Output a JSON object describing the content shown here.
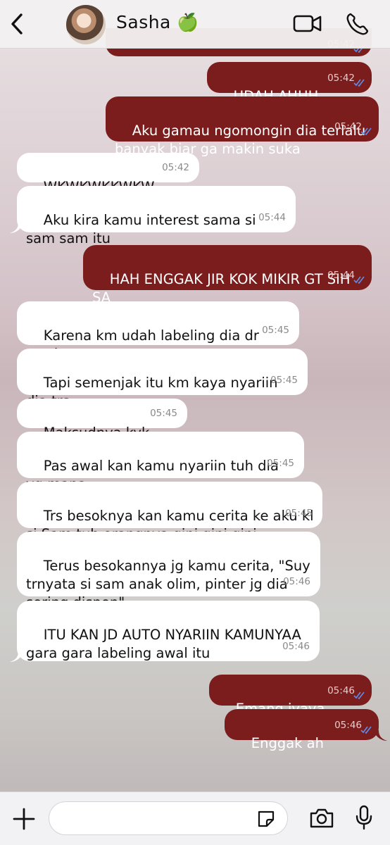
{
  "header": {
    "contact_name": "Sasha 🍏",
    "icons": [
      "back-chevron-icon",
      "video-call-icon",
      "phone-icon"
    ]
  },
  "messages": [
    {
      "dir": "out",
      "text": "UDAH AHHH",
      "time": "05:42",
      "status": "read"
    },
    {
      "dir": "out",
      "text": "Aku gamau ngomongin dia terlalu banyak biar ga makin suka",
      "time": "05:42",
      "status": "read"
    },
    {
      "dir": "in",
      "text": "WKWKWKKWKW",
      "time": "05:42"
    },
    {
      "dir": "in",
      "text": "Aku kira kamu interest sama si sam sam itu",
      "time": "05:44"
    },
    {
      "dir": "out",
      "text": "HAH ENGGAK JIR KOK MIKIR GT SIH SA",
      "time": "05:44",
      "status": "read"
    },
    {
      "dir": "in",
      "text": "Karena km udah labeling dia dr awal",
      "time": "05:45"
    },
    {
      "dir": "in",
      "text": "Tapi semenjak itu km kaya nyariin dia trs",
      "time": "05:45"
    },
    {
      "dir": "in",
      "text": "Maksudnya kyk",
      "time": "05:45"
    },
    {
      "dir": "in",
      "text": "Pas awal kan kamu nyariin tuh dia yg mana",
      "time": "05:45"
    },
    {
      "dir": "in",
      "text": "Trs besoknya kan kamu cerita ke aku kl si Sam tuh orangnya gini gini gini",
      "time": "05:45"
    },
    {
      "dir": "in",
      "text": "Terus besokannya jg kamu cerita, \"Suy trnyata si sam anak olim, pinter jg dia sering dispen\"",
      "time": "05:46"
    },
    {
      "dir": "in",
      "text": "ITU KAN JD AUTO NYARIIN KAMUNYAA gara gara labeling awal itu",
      "time": "05:46"
    },
    {
      "dir": "out",
      "text": "Emang iyaya",
      "time": "05:46",
      "status": "read"
    },
    {
      "dir": "out",
      "text": "Enggak ah",
      "time": "05:46",
      "status": "read"
    }
  ],
  "partial_top_message": {
    "time": "05:42"
  },
  "composer": {
    "placeholder": "",
    "icons": [
      "plus-icon",
      "sticker-icon",
      "camera-icon",
      "microphone-icon"
    ]
  },
  "colors": {
    "outgoing_bubble": "#7c1d1d",
    "incoming_bubble": "#ffffff",
    "read_ticks": "#5a8ff0"
  }
}
